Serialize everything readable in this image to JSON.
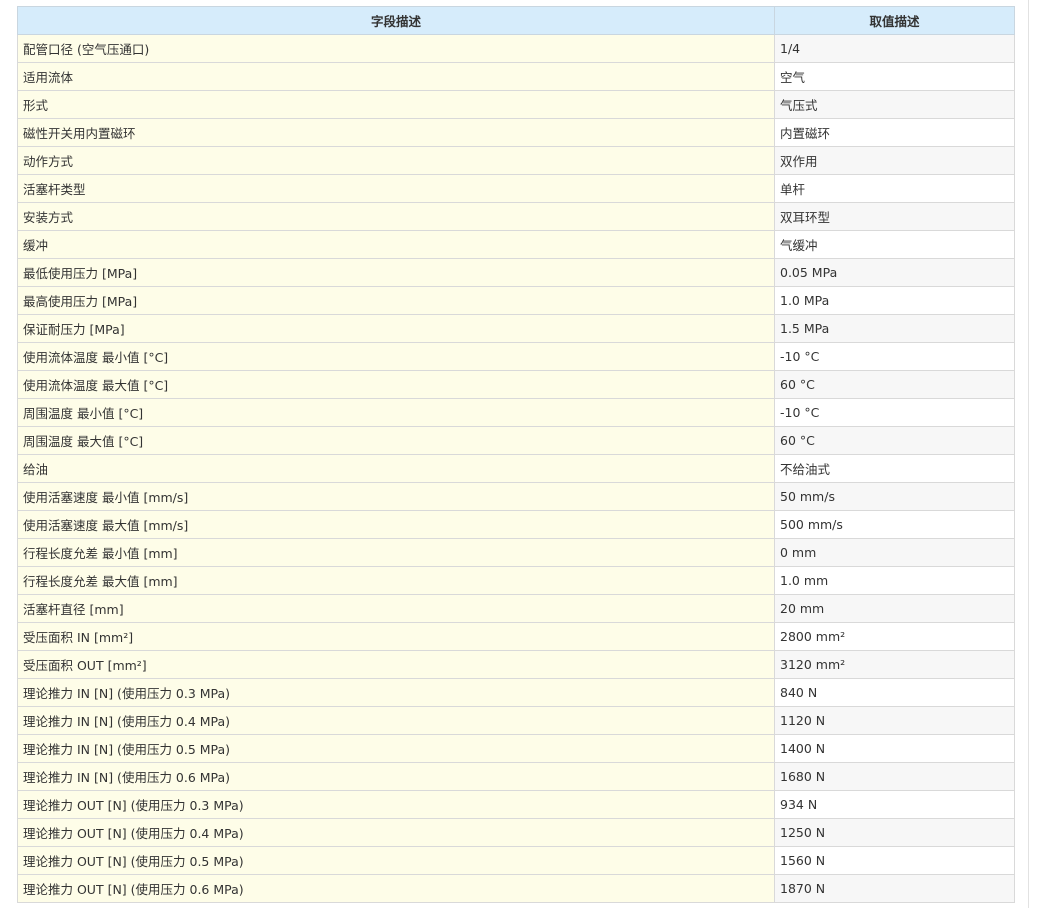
{
  "table": {
    "header": {
      "field": "字段描述",
      "value": "取值描述"
    },
    "rows": [
      {
        "field": "配管口径 (空气压通口)",
        "value": "1/4"
      },
      {
        "field": "适用流体",
        "value": "空气"
      },
      {
        "field": "形式",
        "value": "气压式"
      },
      {
        "field": "磁性开关用内置磁环",
        "value": "内置磁环"
      },
      {
        "field": "动作方式",
        "value": "双作用"
      },
      {
        "field": "活塞杆类型",
        "value": "单杆"
      },
      {
        "field": "安装方式",
        "value": "双耳环型"
      },
      {
        "field": "缓冲",
        "value": "气缓冲"
      },
      {
        "field": "最低使用压力 [MPa]",
        "value": "0.05 MPa"
      },
      {
        "field": "最高使用压力 [MPa]",
        "value": "1.0 MPa"
      },
      {
        "field": "保证耐压力 [MPa]",
        "value": "1.5 MPa"
      },
      {
        "field": "使用流体温度 最小值 [°C]",
        "value": "-10 °C"
      },
      {
        "field": "使用流体温度 最大值 [°C]",
        "value": "60 °C"
      },
      {
        "field": "周围温度 最小值 [°C]",
        "value": "-10 °C"
      },
      {
        "field": "周围温度 最大值 [°C]",
        "value": "60 °C"
      },
      {
        "field": "给油",
        "value": "不给油式"
      },
      {
        "field": "使用活塞速度 最小值 [mm/s]",
        "value": "50 mm/s"
      },
      {
        "field": "使用活塞速度 最大值 [mm/s]",
        "value": "500 mm/s"
      },
      {
        "field": "行程长度允差 最小值 [mm]",
        "value": "0 mm"
      },
      {
        "field": "行程长度允差 最大值 [mm]",
        "value": "1.0 mm"
      },
      {
        "field": "活塞杆直径 [mm]",
        "value": "20 mm"
      },
      {
        "field": "受压面积 IN [mm²]",
        "value": "2800 mm²"
      },
      {
        "field": "受压面积 OUT [mm²]",
        "value": "3120 mm²"
      },
      {
        "field": "理论推力 IN [N] (使用压力 0.3 MPa)",
        "value": "840 N"
      },
      {
        "field": "理论推力 IN [N] (使用压力 0.4 MPa)",
        "value": "1120 N"
      },
      {
        "field": "理论推力 IN [N] (使用压力 0.5 MPa)",
        "value": "1400 N"
      },
      {
        "field": "理论推力 IN [N] (使用压力 0.6 MPa)",
        "value": "1680 N"
      },
      {
        "field": "理论推力 OUT [N] (使用压力 0.3 MPa)",
        "value": "934 N"
      },
      {
        "field": "理论推力 OUT [N] (使用压力 0.4 MPa)",
        "value": "1250 N"
      },
      {
        "field": "理论推力 OUT [N] (使用压力 0.5 MPa)",
        "value": "1560 N"
      },
      {
        "field": "理论推力 OUT [N] (使用压力 0.6 MPa)",
        "value": "1870 N"
      }
    ]
  }
}
